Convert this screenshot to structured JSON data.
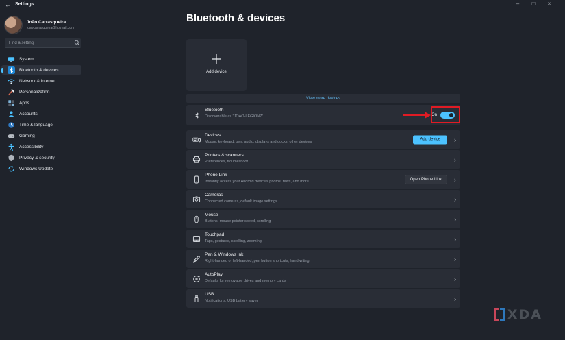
{
  "titlebar": {
    "back": "←",
    "title": "Settings",
    "minimize": "–",
    "maximize": "□",
    "close": "×"
  },
  "profile": {
    "name": "João Carrasqueira",
    "email": "joaocarrasqueira@hotmail.com"
  },
  "search": {
    "placeholder": "Find a setting",
    "icon": "search-icon"
  },
  "sidebar": {
    "items": [
      {
        "label": "System",
        "icon": "system-icon",
        "selected": false
      },
      {
        "label": "Bluetooth & devices",
        "icon": "bluetooth-icon",
        "selected": true
      },
      {
        "label": "Network & internet",
        "icon": "network-icon",
        "selected": false
      },
      {
        "label": "Personalization",
        "icon": "personalization-icon",
        "selected": false
      },
      {
        "label": "Apps",
        "icon": "apps-icon",
        "selected": false
      },
      {
        "label": "Accounts",
        "icon": "accounts-icon",
        "selected": false
      },
      {
        "label": "Time & language",
        "icon": "time-language-icon",
        "selected": false
      },
      {
        "label": "Gaming",
        "icon": "gaming-icon",
        "selected": false
      },
      {
        "label": "Accessibility",
        "icon": "accessibility-icon",
        "selected": false
      },
      {
        "label": "Privacy & security",
        "icon": "privacy-icon",
        "selected": false
      },
      {
        "label": "Windows Update",
        "icon": "windows-update-icon",
        "selected": false
      }
    ]
  },
  "main": {
    "title": "Bluetooth & devices",
    "add_device_tile": {
      "label": "Add device",
      "icon": "plus-icon"
    },
    "view_more_label": "View more devices",
    "chevron": "›",
    "bluetooth_row": {
      "title": "Bluetooth",
      "subtitle": "Discoverable as \"JOAO-LEGION7\"",
      "toggle_label": "On",
      "toggle_state": "on",
      "icon": "bluetooth-glyph-icon"
    },
    "rows": [
      {
        "title": "Devices",
        "subtitle": "Mouse, keyboard, pen, audio, displays and docks, other devices",
        "icon": "devices-icon",
        "button": "Add device"
      },
      {
        "title": "Printers & scanners",
        "subtitle": "Preferences, troubleshoot",
        "icon": "printer-icon"
      },
      {
        "title": "Phone Link",
        "subtitle": "Instantly access your Android device's photos, texts, and more",
        "icon": "phone-icon",
        "button": "Open Phone Link"
      },
      {
        "title": "Cameras",
        "subtitle": "Connected cameras, default image settings",
        "icon": "camera-icon"
      },
      {
        "title": "Mouse",
        "subtitle": "Buttons, mouse pointer speed, scrolling",
        "icon": "mouse-icon"
      },
      {
        "title": "Touchpad",
        "subtitle": "Taps, gestures, scrolling, zooming",
        "icon": "touchpad-icon"
      },
      {
        "title": "Pen & Windows Ink",
        "subtitle": "Right-handed or left-handed, pen button shortcuts, handwriting",
        "icon": "pen-icon"
      },
      {
        "title": "AutoPlay",
        "subtitle": "Defaults for removable drives and memory cards",
        "icon": "autoplay-icon"
      },
      {
        "title": "USB",
        "subtitle": "Notifications, USB battery saver",
        "icon": "usb-icon"
      }
    ]
  },
  "annotation": {
    "type": "arrow-and-box",
    "color": "#e01b24",
    "target": "bluetooth-toggle"
  },
  "watermark": {
    "text": "XDA"
  },
  "colors": {
    "background": "#1f232b",
    "card": "#292d36",
    "accent": "#4cc2ff",
    "link": "#5fb2e6",
    "annotation": "#e01b24",
    "subtitle": "#969da7"
  }
}
